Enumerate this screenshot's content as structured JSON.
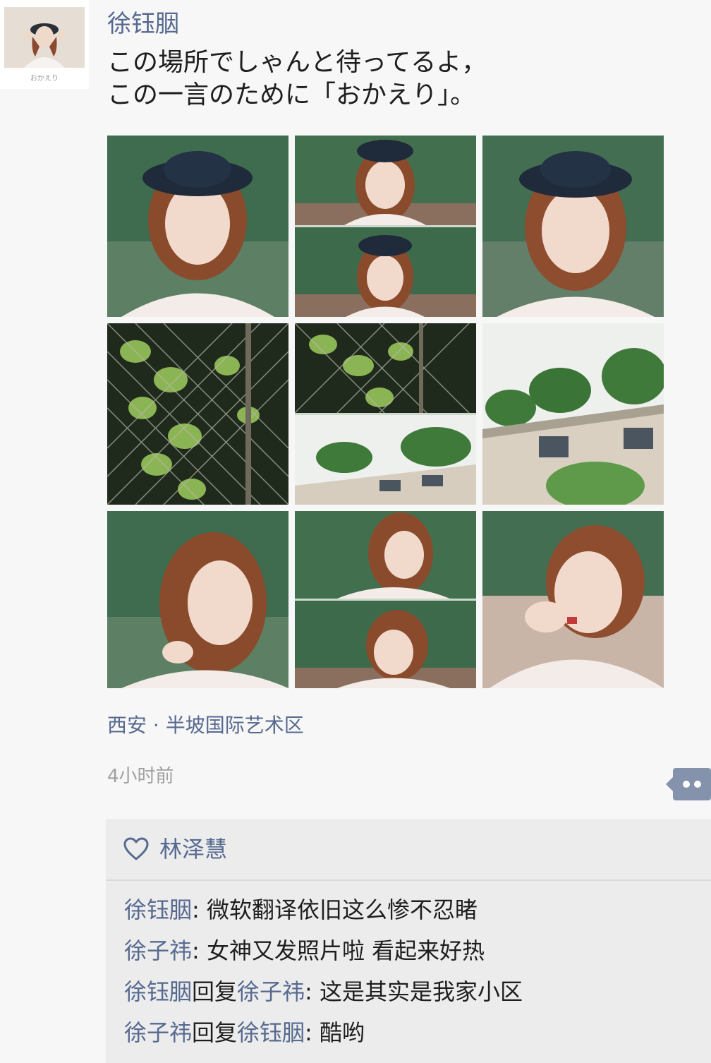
{
  "post": {
    "user_name": "徐钰胭",
    "avatar_caption": "おかえり",
    "text_lines": [
      "この場所でしゃんと待ってるよ，",
      "この一言のために「おかえり」。"
    ],
    "photos": [
      {
        "subject": "portrait-hat"
      },
      {
        "subject": "portrait-hat-double"
      },
      {
        "subject": "portrait-hat"
      },
      {
        "subject": "fence-leaves"
      },
      {
        "subject": "fence-building-double"
      },
      {
        "subject": "building-trees"
      },
      {
        "subject": "portrait-hair"
      },
      {
        "subject": "portrait-hair-double"
      },
      {
        "subject": "portrait-hand"
      }
    ],
    "location": "西安 · 半坡国际艺术区",
    "time_ago": "4小时前"
  },
  "likes": {
    "icon": "heart-icon",
    "names": "林泽慧"
  },
  "comments": [
    {
      "from": "徐钰胭",
      "reply_word": "",
      "to": "",
      "sep": ": ",
      "text": "微软翻译依旧这么惨不忍睹"
    },
    {
      "from": "徐子祎",
      "reply_word": "",
      "to": "",
      "sep": ": ",
      "text": "女神又发照片啦 看起来好热"
    },
    {
      "from": "徐钰胭",
      "reply_word": "回复",
      "to": "徐子祎",
      "sep": ": ",
      "text": "这是其实是我家小区"
    },
    {
      "from": "徐子祎",
      "reply_word": "回复",
      "to": "徐钰胭",
      "sep": ": ",
      "text": "酷哟"
    }
  ],
  "colors": {
    "link": "#56698f",
    "background": "#f7f7f7",
    "panel": "#ececec",
    "comment_button": "#8592ab"
  }
}
